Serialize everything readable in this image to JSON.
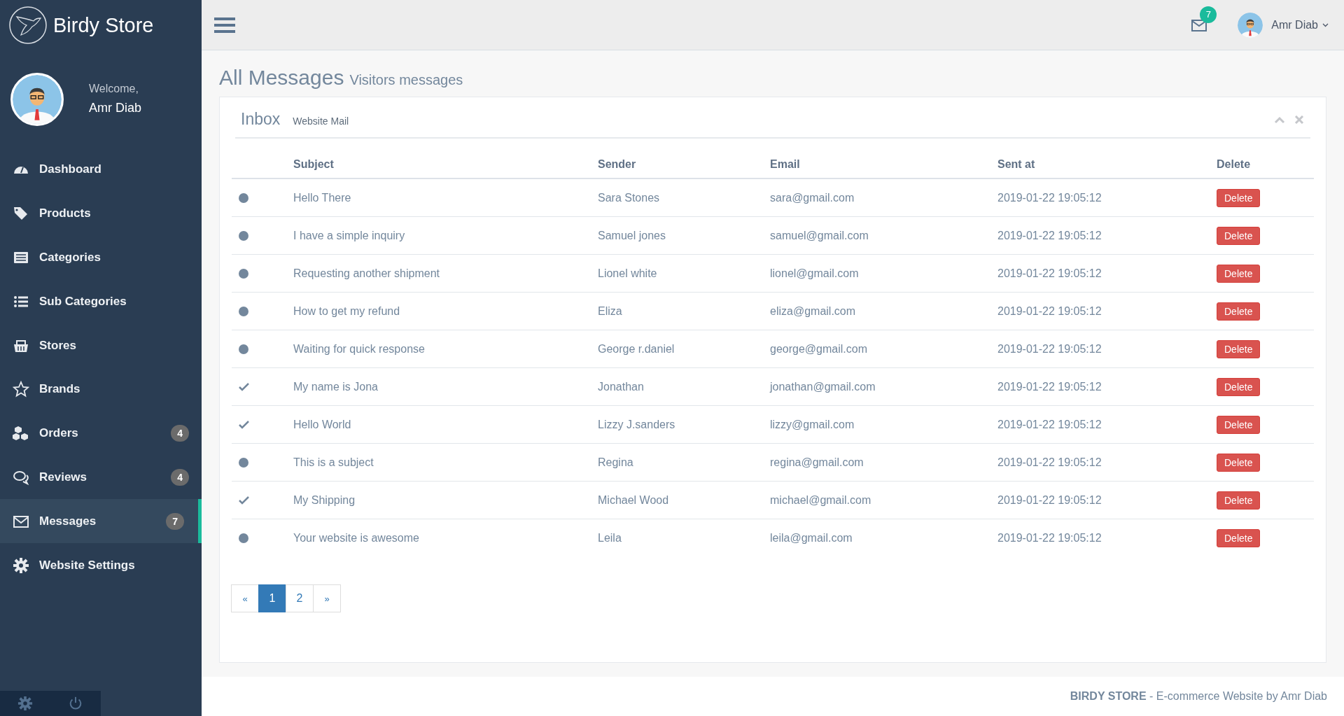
{
  "brand": {
    "name": "Birdy Store"
  },
  "user_panel": {
    "greeting": "Welcome,",
    "name": "Amr Diab"
  },
  "sidebar": {
    "items": [
      {
        "label": "Dashboard",
        "kind": "dashboard",
        "selected": false
      },
      {
        "label": "Products",
        "kind": "tags",
        "selected": false
      },
      {
        "label": "Categories",
        "kind": "list-alt",
        "selected": false
      },
      {
        "label": "Sub Categories",
        "kind": "list",
        "selected": false
      },
      {
        "label": "Stores",
        "kind": "basket",
        "selected": false
      },
      {
        "label": "Brands",
        "kind": "star",
        "selected": false
      },
      {
        "label": "Orders",
        "kind": "cubes",
        "badge": "4",
        "selected": false
      },
      {
        "label": "Reviews",
        "kind": "comments",
        "badge": "4",
        "selected": false
      },
      {
        "label": "Messages",
        "kind": "envelope",
        "badge": "7",
        "selected": true
      },
      {
        "label": "Website Settings",
        "kind": "gear",
        "selected": false
      }
    ]
  },
  "topbar": {
    "mail_count": "7",
    "user_name": "Amr Diab"
  },
  "page": {
    "title": "All Messages",
    "subtitle": "Visitors messages"
  },
  "panel": {
    "title": "Inbox",
    "subtitle": "Website Mail"
  },
  "table": {
    "columns": [
      "Subject",
      "Sender",
      "Email",
      "Sent at",
      "Delete"
    ],
    "rows": [
      {
        "read": false,
        "subject": "Hello There",
        "sender": "Sara Stones",
        "email": "sara@gmail.com",
        "sent_at": "2019-01-22 19:05:12",
        "action": "Delete"
      },
      {
        "read": false,
        "subject": "I have a simple inquiry",
        "sender": "Samuel jones",
        "email": "samuel@gmail.com",
        "sent_at": "2019-01-22 19:05:12",
        "action": "Delete"
      },
      {
        "read": false,
        "subject": "Requesting another shipment",
        "sender": "Lionel white",
        "email": "lionel@gmail.com",
        "sent_at": "2019-01-22 19:05:12",
        "action": "Delete"
      },
      {
        "read": false,
        "subject": "How to get my refund",
        "sender": "Eliza",
        "email": "eliza@gmail.com",
        "sent_at": "2019-01-22 19:05:12",
        "action": "Delete"
      },
      {
        "read": false,
        "subject": "Waiting for quick response",
        "sender": "George r.daniel",
        "email": "george@gmail.com",
        "sent_at": "2019-01-22 19:05:12",
        "action": "Delete"
      },
      {
        "read": true,
        "subject": "My name is Jona",
        "sender": "Jonathan",
        "email": "jonathan@gmail.com",
        "sent_at": "2019-01-22 19:05:12",
        "action": "Delete"
      },
      {
        "read": true,
        "subject": "Hello World",
        "sender": "Lizzy J.sanders",
        "email": "lizzy@gmail.com",
        "sent_at": "2019-01-22 19:05:12",
        "action": "Delete"
      },
      {
        "read": false,
        "subject": "This is a subject",
        "sender": "Regina",
        "email": "regina@gmail.com",
        "sent_at": "2019-01-22 19:05:12",
        "action": "Delete"
      },
      {
        "read": true,
        "subject": "My Shipping",
        "sender": "Michael Wood",
        "email": "michael@gmail.com",
        "sent_at": "2019-01-22 19:05:12",
        "action": "Delete"
      },
      {
        "read": false,
        "subject": "Your website is awesome",
        "sender": "Leila",
        "email": "leila@gmail.com",
        "sent_at": "2019-01-22 19:05:12",
        "action": "Delete"
      }
    ]
  },
  "pagination": [
    {
      "label": "«",
      "kind": "prev",
      "selected": false
    },
    {
      "label": "1",
      "kind": "page",
      "selected": true
    },
    {
      "label": "2",
      "kind": "page",
      "selected": false
    },
    {
      "label": "»",
      "kind": "next",
      "selected": false
    }
  ],
  "footer": {
    "text": "**BIRDY STORE** - E-commerce Website by Amr Diab"
  }
}
